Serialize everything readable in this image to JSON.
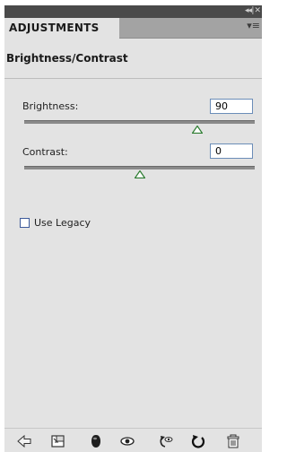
{
  "panel": {
    "tab_label": "ADJUSTMENTS",
    "title": "Brightness/Contrast"
  },
  "brightness": {
    "label": "Brightness:",
    "value": "90",
    "slider_fraction": 0.75
  },
  "contrast": {
    "label": "Contrast:",
    "value": "0",
    "slider_fraction": 0.5
  },
  "use_legacy": {
    "label": "Use Legacy",
    "checked": false
  },
  "footer_icons": [
    "back-arrow-icon",
    "clip-to-layer-icon",
    "layer-visibility-icon",
    "view-previous-state-icon",
    "reset-icon",
    "refresh-icon",
    "trash-icon"
  ]
}
